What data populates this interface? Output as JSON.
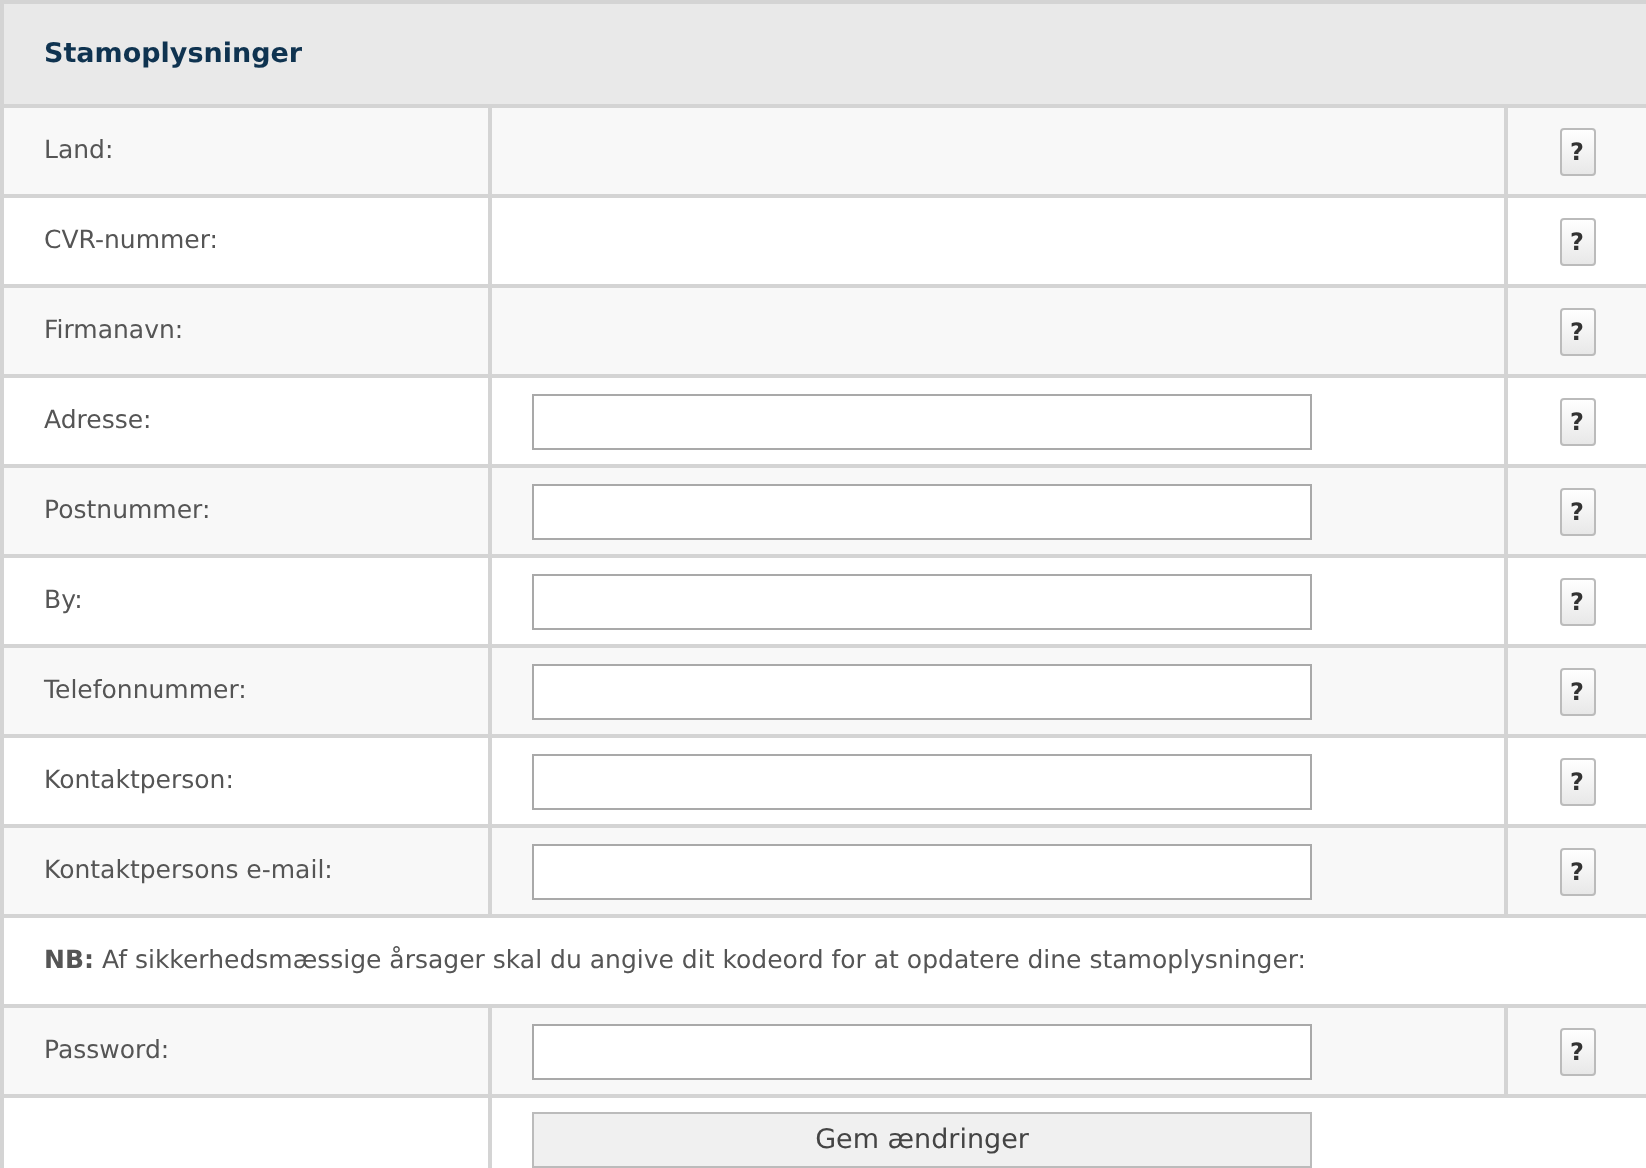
{
  "title": "Stamoplysninger",
  "rows": [
    {
      "kind": "static",
      "label": "Land:",
      "help": "?"
    },
    {
      "kind": "static",
      "label": "CVR-nummer:",
      "help": "?"
    },
    {
      "kind": "static",
      "label": "Firmanavn:",
      "help": "?"
    },
    {
      "kind": "input",
      "label": "Adresse:",
      "help": "?"
    },
    {
      "kind": "input",
      "label": "Postnummer:",
      "help": "?"
    },
    {
      "kind": "input",
      "label": "By:",
      "help": "?"
    },
    {
      "kind": "input",
      "label": "Telefonnummer:",
      "help": "?"
    },
    {
      "kind": "input",
      "label": "Kontaktperson:",
      "help": "?"
    },
    {
      "kind": "input",
      "label": "Kontaktpersons e-mail:",
      "help": "?"
    },
    {
      "kind": "note",
      "text": "**NB:** Af sikkerhedsmæssige årsager skal du angive dit kodeord for at opdatere dine stamoplysninger:"
    },
    {
      "kind": "password",
      "label": "Password:",
      "help": "?"
    },
    {
      "kind": "submit",
      "button": "Gem ændringer"
    }
  ]
}
